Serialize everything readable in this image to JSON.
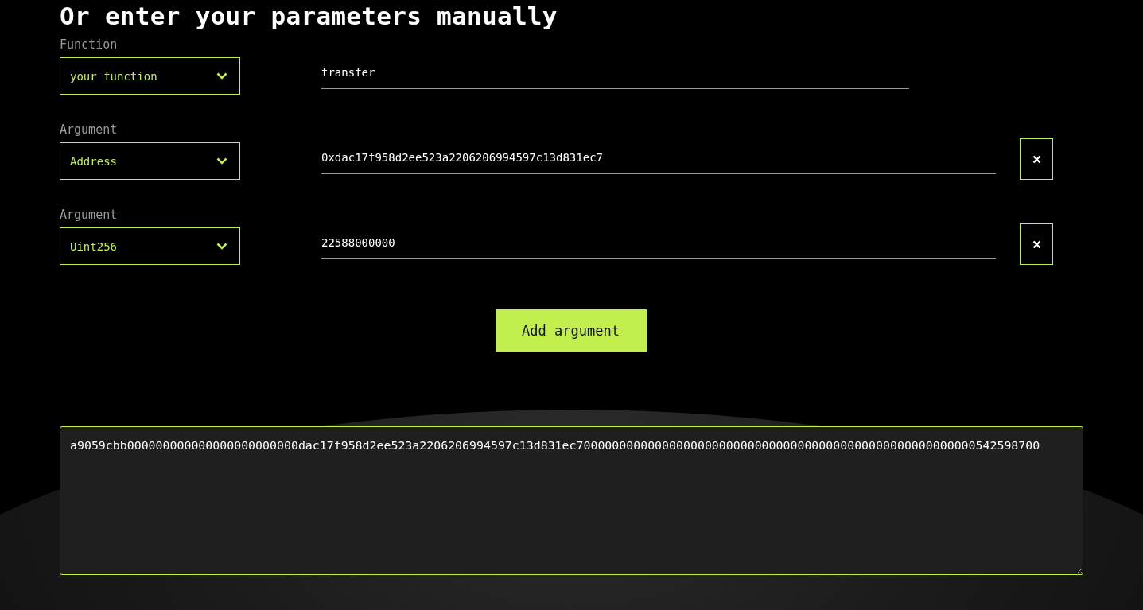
{
  "heading": "Or enter your parameters manually",
  "function": {
    "label": "Function",
    "select": "your function",
    "value": "transfer"
  },
  "arguments": [
    {
      "label": "Argument",
      "type": "Address",
      "value": "0xdac17f958d2ee523a2206206994597c13d831ec7"
    },
    {
      "label": "Argument",
      "type": "Uint256",
      "value": "22588000000"
    }
  ],
  "add_button": "Add argument",
  "output": {
    "value": "a9059cbb000000000000000000000000dac17f958d2ee523a2206206994597c13d831ec70000000000000000000000000000000000000000000000000000000542598700"
  }
}
